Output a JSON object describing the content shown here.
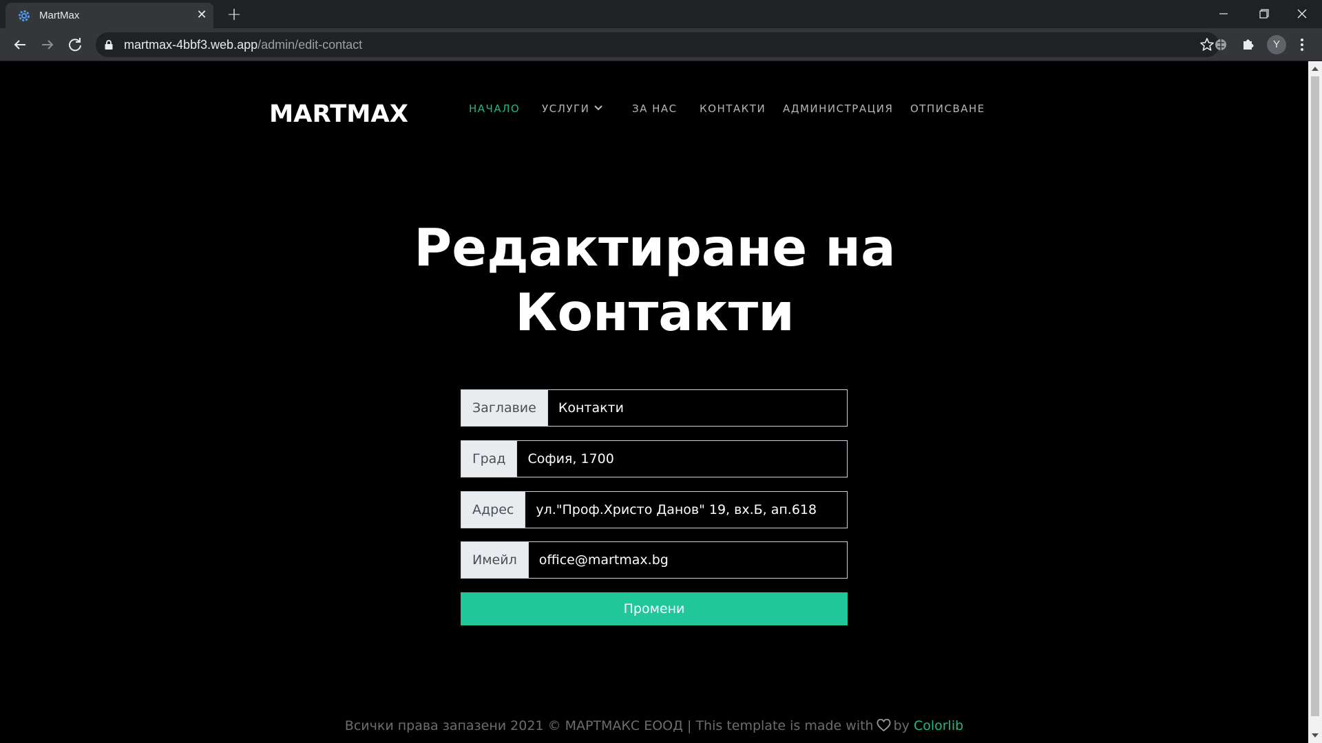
{
  "browser": {
    "tab_title": "MartMax",
    "url_host": "martmax-4bbf3.web.app",
    "url_path": "/admin/edit-contact",
    "profile_initial": "Y",
    "icons": [
      "back-icon",
      "forward-icon",
      "reload-icon",
      "lock-icon",
      "star-icon",
      "extension-icon",
      "puzzle-icon",
      "menu-icon"
    ]
  },
  "site": {
    "logo": "MARTMAX",
    "nav": [
      {
        "label": "НАЧАЛО",
        "active": true
      },
      {
        "label": "УСЛУГИ",
        "dropdown": true
      },
      {
        "label": "ЗА НАС"
      },
      {
        "label": "КОНТАКТИ"
      },
      {
        "label": "АДМИНИСТРАЦИЯ"
      },
      {
        "label": "ОТПИСВАНЕ"
      }
    ]
  },
  "page": {
    "heading_line1": "Редактиране на",
    "heading_line2": "Контакти"
  },
  "form": {
    "title": {
      "label": "Заглавие",
      "value": "Контакти"
    },
    "city": {
      "label": "Град",
      "value": "София, 1700"
    },
    "address": {
      "label": "Адрес",
      "value": "ул.\"Проф.Христо Данов\" 19, вх.Б, ап.618"
    },
    "email": {
      "label": "Имейл",
      "value": "office@martmax.bg"
    },
    "submit_label": "Промени"
  },
  "footer": {
    "text_before": "Всички права запазени 2021 © МАРТМАКС ЕООД | This template is made with",
    "text_by": "by",
    "link": "Colorlib"
  },
  "colors": {
    "accent": "#1fc79b",
    "nav_active": "#1fb98b",
    "background": "#000000"
  }
}
